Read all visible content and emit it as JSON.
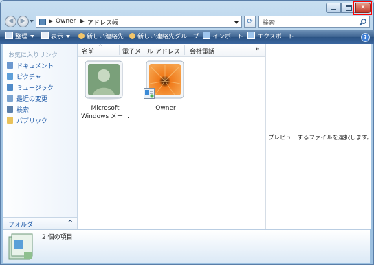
{
  "window": {
    "minimize_icon": "minimize-icon",
    "maximize_icon": "maximize-icon",
    "close_label": "✕",
    "highlight_color": "#ff0000"
  },
  "address_bar": {
    "crumbs": [
      "Owner",
      "アドレス帳"
    ]
  },
  "search": {
    "placeholder": "検索"
  },
  "toolbar": {
    "organize": "整理",
    "view": "表示",
    "new_contact": "新しい連絡先",
    "new_group": "新しい連絡先グループ",
    "import": "インポート",
    "export": "エクスポート",
    "help": "?"
  },
  "left_pane": {
    "title": "お気に入りリンク",
    "items": [
      {
        "label": "ドキュメント",
        "icon": "document-icon"
      },
      {
        "label": "ピクチャ",
        "icon": "pictures-icon"
      },
      {
        "label": "ミュージック",
        "icon": "music-icon"
      },
      {
        "label": "最近の変更",
        "icon": "recent-icon"
      },
      {
        "label": "検索",
        "icon": "search-folder-icon"
      },
      {
        "label": "パブリック",
        "icon": "public-icon"
      }
    ],
    "folders_label": "フォルダ",
    "folders_chevron": "^"
  },
  "columns": [
    "名前",
    "電子メール アドレス",
    "会社電話"
  ],
  "columns_more": "»",
  "items": [
    {
      "label_line1": "Microsoft",
      "label_line2": "Windows メー…"
    },
    {
      "label_line1": "Owner",
      "label_line2": ""
    }
  ],
  "preview": {
    "text": "プレビューするファイルを選択します。"
  },
  "status": {
    "count_text": "2 個の項目"
  }
}
